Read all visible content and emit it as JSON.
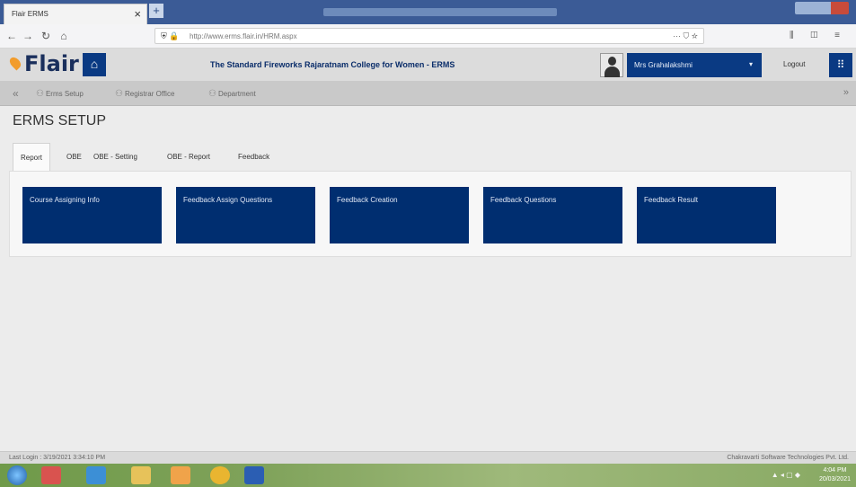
{
  "browser": {
    "tab_title": "Flair ERMS",
    "tab_close": "×",
    "new_tab": "+",
    "url": "http://www.erms.flair.in/HRM.aspx",
    "url_actions": "··· ⛉ ☆",
    "toolbar_right": "⫼ ◫ ≡"
  },
  "header": {
    "logo_text": "Flair",
    "college_name": "The Standard Fireworks Rajaratnam College for Women - ERMS",
    "user_name": "Mrs Grahalakshmi",
    "user_caret": "▾",
    "logout": "Logout",
    "grid_glyph": "⠿",
    "home_glyph": "⌂"
  },
  "modules": {
    "left_glyph": "«",
    "right_glyph": "»",
    "items": [
      "Erms Setup",
      "Registrar Office",
      "Department"
    ]
  },
  "page": {
    "title": "ERMS SETUP",
    "tabs": [
      "Report",
      "OBE",
      "OBE - Setting",
      "OBE - Report",
      "Feedback"
    ],
    "active_tab": "Report",
    "tiles": [
      "Course Assigning Info",
      "Feedback Assign Questions",
      "Feedback Creation",
      "Feedback Questions",
      "Feedback Result"
    ],
    "tile_color": "#002e70"
  },
  "footer": {
    "last_login": "Last Login : 3/19/2021 3:34:10 PM",
    "company": "Chakravarti Software Technologies Pvt. Ltd."
  },
  "taskbar": {
    "tray": "▲ ◂ ▢ ◆",
    "time": "4:04 PM",
    "date": "20/03/2021"
  }
}
